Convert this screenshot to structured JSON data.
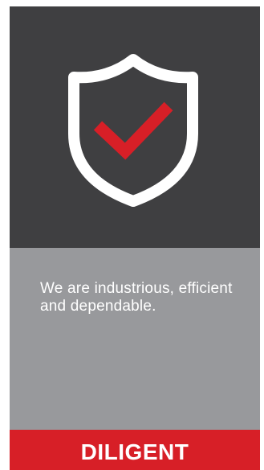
{
  "card": {
    "icon": "shield-check-icon",
    "description": "We are industrious, efficient and dependable.",
    "title": "DILIGENT"
  },
  "colors": {
    "top_panel": "#3f3f41",
    "middle_panel": "#98999c",
    "bottom_panel": "#d71f27",
    "shield_outline": "#ffffff",
    "checkmark": "#d71f27",
    "text": "#ffffff"
  }
}
